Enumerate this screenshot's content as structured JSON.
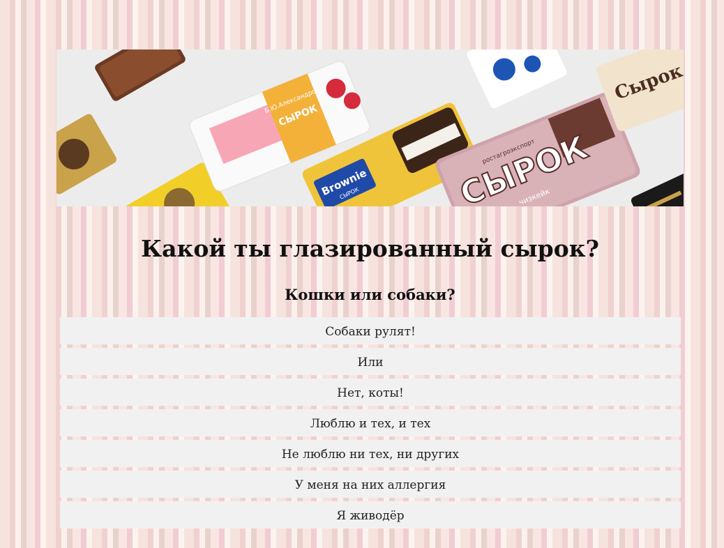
{
  "banner": {
    "products": [
      {
        "brand": "Б.Ю.Александров",
        "text": "СЫРОК"
      },
      {
        "brand": "Brownie",
        "text": "СЫРОК"
      },
      {
        "brand": "ростагроэкспорт",
        "text": "СЫРОК",
        "subtext": "чизкейк"
      },
      {
        "brand": "",
        "text": "Сырок"
      }
    ]
  },
  "quiz": {
    "title": "Какой ты глазированный сырок?",
    "question": "Кошки или собаки?",
    "answers": [
      "Собаки рулят!",
      "Или",
      "Нет, коты!",
      "Люблю и тех, и тех",
      "Не люблю ни тех, ни других",
      "У меня на них аллергия",
      "Я живодёр"
    ]
  }
}
